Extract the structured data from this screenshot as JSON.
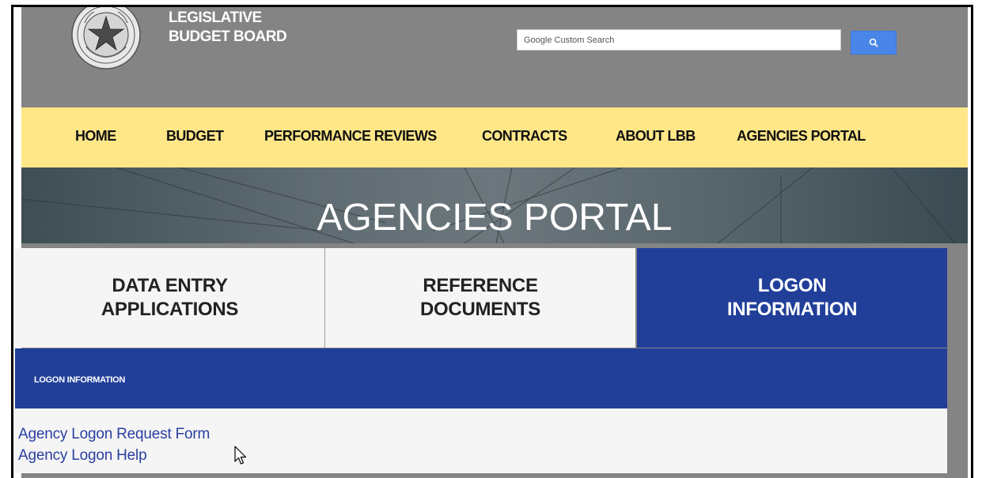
{
  "header": {
    "org_line1": "LEGISLATIVE",
    "org_line2": "BUDGET BOARD",
    "search_placeholder": "Google Custom Search"
  },
  "nav": {
    "items": [
      "HOME",
      "BUDGET",
      "PERFORMANCE REVIEWS",
      "CONTRACTS",
      "ABOUT LBB",
      "AGENCIES PORTAL"
    ]
  },
  "banner": {
    "title": "AGENCIES PORTAL"
  },
  "tabs": [
    {
      "line1": "DATA ENTRY",
      "line2": "APPLICATIONS",
      "active": false
    },
    {
      "line1": "REFERENCE",
      "line2": "DOCUMENTS",
      "active": false
    },
    {
      "line1": "LOGON",
      "line2": "INFORMATION",
      "active": true
    }
  ],
  "section": {
    "title": "LOGON INFORMATION"
  },
  "links": [
    "Agency Logon Request Form",
    "Agency Logon Help"
  ],
  "colors": {
    "header_gray": "#848484",
    "nav_yellow": "#ffe788",
    "active_blue": "#213f99",
    "link_blue": "#2a3fa0",
    "search_button": "#4a86e8"
  },
  "icons": [
    "texas-state-seal-icon",
    "search-icon",
    "mouse-pointer-icon"
  ]
}
